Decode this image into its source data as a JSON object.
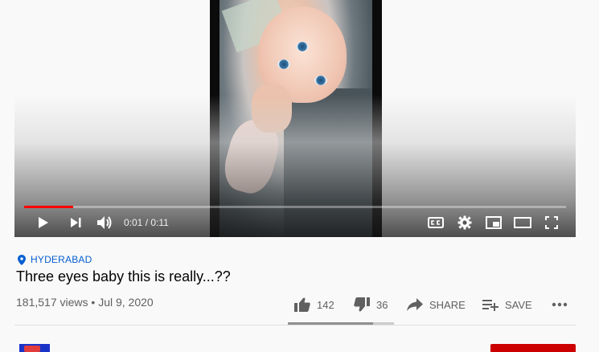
{
  "player": {
    "progress_fraction": 0.0909,
    "time_current": "0:01",
    "time_separator": "/",
    "time_total": "0:11"
  },
  "video": {
    "location": "HYDERABAD",
    "title": "Three eyes baby this is really...??",
    "views": "181,517 views",
    "date": "Jul 9, 2020",
    "meta_separator": "•"
  },
  "actions": {
    "likes": "142",
    "dislikes": "36",
    "share_label": "SHARE",
    "save_label": "SAVE",
    "like_fraction": 0.8
  },
  "colors": {
    "progress": "#ff0000",
    "link": "#065fd4",
    "subscribe": "#cc0000"
  }
}
